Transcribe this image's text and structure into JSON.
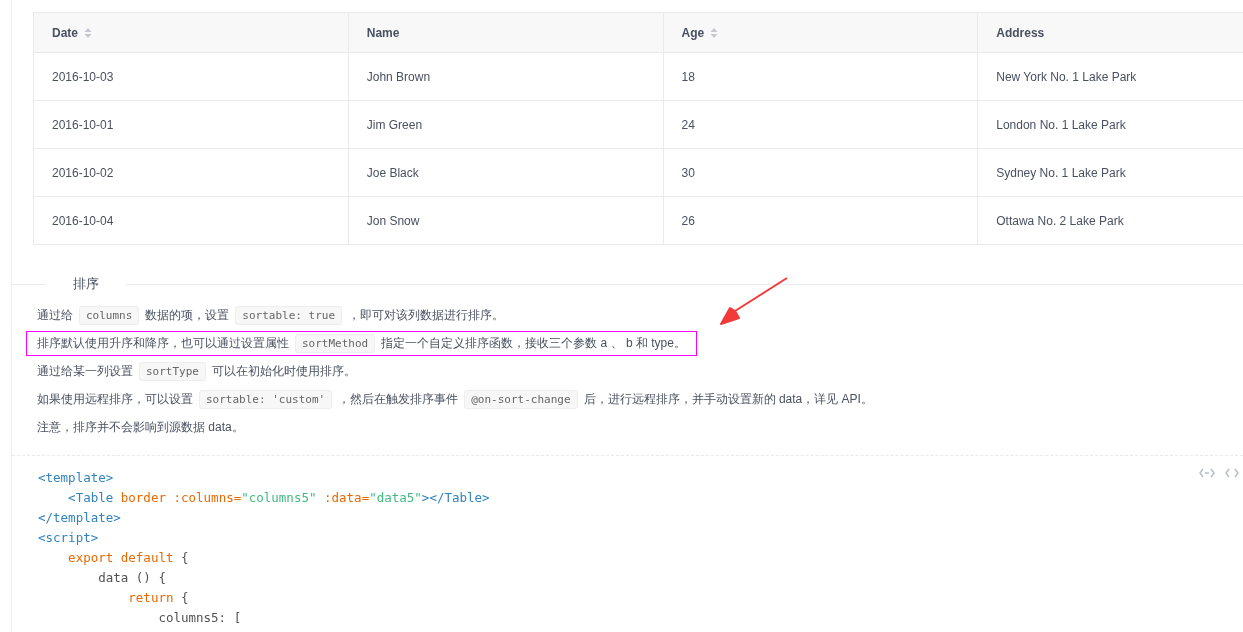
{
  "table": {
    "columns": [
      {
        "label": "Date",
        "sortable": true
      },
      {
        "label": "Name",
        "sortable": false
      },
      {
        "label": "Age",
        "sortable": true
      },
      {
        "label": "Address",
        "sortable": false
      }
    ],
    "rows": [
      [
        "2016-10-03",
        "John Brown",
        "18",
        "New York No. 1 Lake Park"
      ],
      [
        "2016-10-01",
        "Jim Green",
        "24",
        "London No. 1 Lake Park"
      ],
      [
        "2016-10-02",
        "Joe Black",
        "30",
        "Sydney No. 1 Lake Park"
      ],
      [
        "2016-10-04",
        "Jon Snow",
        "26",
        "Ottawa No. 2 Lake Park"
      ]
    ]
  },
  "section": {
    "title": "排序",
    "paragraphs": [
      {
        "highlighted": false,
        "parts": [
          {
            "kind": "text",
            "text": "通过给"
          },
          {
            "kind": "code",
            "text": "columns"
          },
          {
            "kind": "text",
            "text": "数据的项，设置"
          },
          {
            "kind": "code",
            "text": "sortable: true"
          },
          {
            "kind": "text",
            "text": "，即可对该列数据进行排序。"
          }
        ]
      },
      {
        "highlighted": true,
        "parts": [
          {
            "kind": "text",
            "text": "排序默认使用升序和降序，也可以通过设置属性"
          },
          {
            "kind": "code",
            "text": "sortMethod"
          },
          {
            "kind": "text",
            "text": "指定一个自定义排序函数，接收三个参数 a 、 b 和 type。"
          }
        ]
      },
      {
        "highlighted": false,
        "parts": [
          {
            "kind": "text",
            "text": "通过给某一列设置"
          },
          {
            "kind": "code",
            "text": "sortType"
          },
          {
            "kind": "text",
            "text": "可以在初始化时使用排序。"
          }
        ]
      },
      {
        "highlighted": false,
        "parts": [
          {
            "kind": "text",
            "text": "如果使用远程排序，可以设置"
          },
          {
            "kind": "code",
            "text": "sortable: 'custom'"
          },
          {
            "kind": "text",
            "text": "，然后在触发排序事件"
          },
          {
            "kind": "code",
            "text": "@on-sort-change"
          },
          {
            "kind": "text",
            "text": "后，进行远程排序，并手动设置新的 data，详见 API。"
          }
        ]
      },
      {
        "highlighted": false,
        "parts": [
          {
            "kind": "text",
            "text": "注意，排序并不会影响到源数据 data。"
          }
        ]
      }
    ]
  },
  "code": {
    "lines": [
      [
        {
          "kind": "tag",
          "text": "<template>"
        }
      ],
      [
        {
          "kind": "tag",
          "text": "    <Table "
        },
        {
          "kind": "attr",
          "text": "border :columns="
        },
        {
          "kind": "string",
          "text": "\"columns5\""
        },
        {
          "kind": "attr",
          "text": " :data="
        },
        {
          "kind": "string",
          "text": "\"data5\""
        },
        {
          "kind": "tag",
          "text": "></Table>"
        }
      ],
      [
        {
          "kind": "tag",
          "text": "</template>"
        }
      ],
      [
        {
          "kind": "tag",
          "text": "<script>"
        }
      ],
      [
        {
          "kind": "keyword",
          "text": "    export default"
        },
        {
          "kind": "plain",
          "text": " {"
        }
      ],
      [
        {
          "kind": "plain",
          "text": "        data () {"
        }
      ],
      [
        {
          "kind": "keyword",
          "text": "            return"
        },
        {
          "kind": "plain",
          "text": " {"
        }
      ],
      [
        {
          "kind": "plain",
          "text": "                columns5: ["
        }
      ]
    ]
  }
}
